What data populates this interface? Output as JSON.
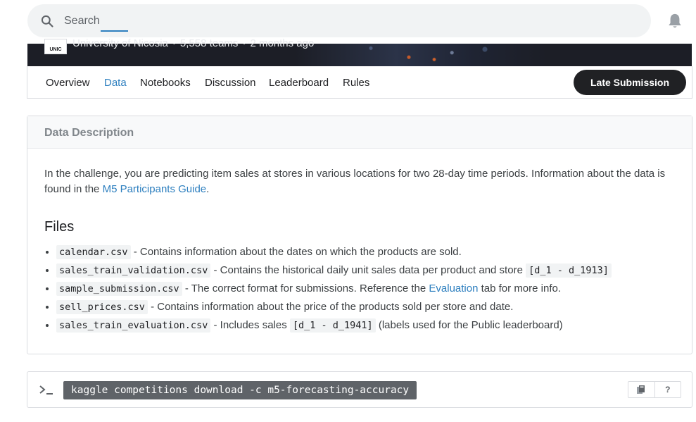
{
  "search": {
    "placeholder": "Search"
  },
  "banner": {
    "logo_text": "UNIC",
    "host": "University of Nicosia",
    "teams": "5,558 teams",
    "time": "2 months ago",
    "separator": "·"
  },
  "tabs": [
    {
      "label": "Overview"
    },
    {
      "label": "Data",
      "active": true
    },
    {
      "label": "Notebooks"
    },
    {
      "label": "Discussion"
    },
    {
      "label": "Leaderboard"
    },
    {
      "label": "Rules"
    }
  ],
  "late_submission_label": "Late Submission",
  "data_description": {
    "title": "Data Description",
    "text": "In the challenge, you are predicting item sales at stores in various locations for two 28-day time periods. Information about the data is found in the ",
    "link": "M5 Participants Guide",
    "text_end": "."
  },
  "files": {
    "title": "Files",
    "items": [
      {
        "code": "calendar.csv",
        "text": " - Contains information about the dates on which the products are sold."
      },
      {
        "code": "sales_train_validation.csv",
        "text": " - Contains the historical daily unit sales data per product and store ",
        "code2": "[d_1 - d_1913]"
      },
      {
        "code": "sample_submission.csv",
        "text": " - The correct format for submissions. Reference the ",
        "link": "Evaluation",
        "text_end": " tab for more info."
      },
      {
        "code": "sell_prices.csv",
        "text": " - Contains information about the price of the products sold per store and date."
      },
      {
        "code": "sales_train_evaluation.csv",
        "text": " - Includes sales ",
        "code2": "[d_1 - d_1941]",
        "text_end": " (labels used for the Public leaderboard)"
      }
    ]
  },
  "command": {
    "text": "kaggle competitions download -c m5-forecasting-accuracy",
    "help_label": "?"
  },
  "icons": {
    "search": "search-icon",
    "bell": "bell-icon",
    "prompt": "terminal-prompt-icon",
    "copy": "copy-icon"
  },
  "colors": {
    "accent": "#2d7fbf",
    "button_dark": "#202124",
    "command_bg": "#5f6368"
  }
}
